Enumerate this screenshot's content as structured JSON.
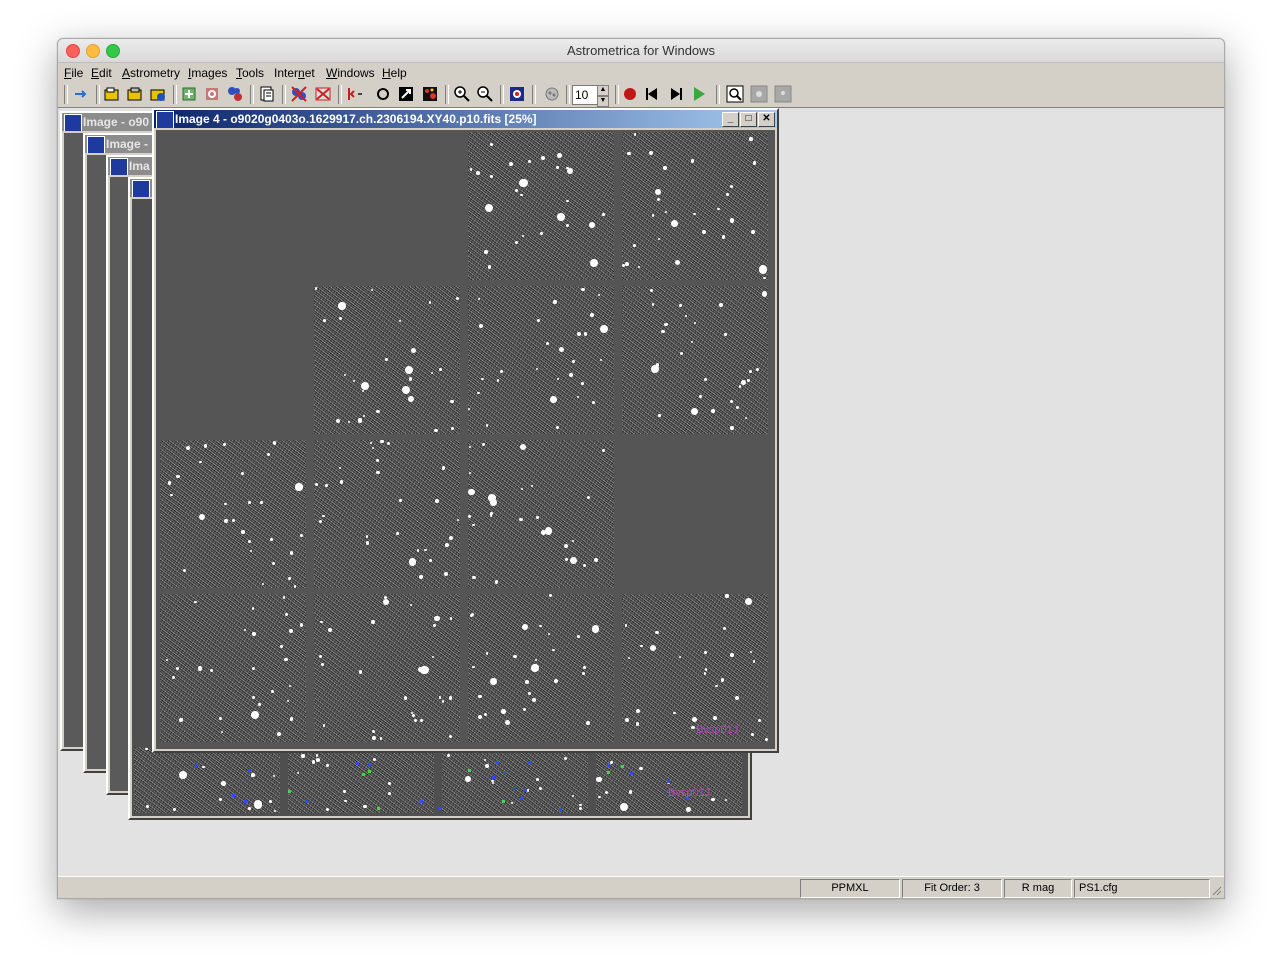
{
  "window": {
    "title": "Astrometrica for Windows"
  },
  "menu": [
    {
      "label": "File",
      "acc": "F",
      "rest": "ile"
    },
    {
      "label": "Edit",
      "acc": "E",
      "rest": "dit"
    },
    {
      "label": "Astrometry",
      "acc": "A",
      "rest": "strometry"
    },
    {
      "label": "Images",
      "acc": "I",
      "rest": "mages"
    },
    {
      "label": "Tools",
      "acc": "T",
      "rest": "ools"
    },
    {
      "label": "Internet",
      "pre": "Inter",
      "acc": "n",
      "rest": "et"
    },
    {
      "label": "Windows",
      "acc": "W",
      "rest": "indows"
    },
    {
      "label": "Help",
      "acc": "H",
      "rest": "elp"
    }
  ],
  "toolbar": {
    "spin_value": "10"
  },
  "child_windows": {
    "back1_title": "Image - o90",
    "back2_title": "Image -",
    "back3_title": "Ima",
    "front_title": "Image 4 - o9020g0403o.1629917.ch.2306194.XY40.p10.fits [25%]"
  },
  "image_label": "Bvsp01J",
  "statusbar": {
    "catalog": "PPMXL",
    "fit_order": "Fit Order: 3",
    "mag_band": "R mag",
    "config": "PS1.cfg"
  }
}
